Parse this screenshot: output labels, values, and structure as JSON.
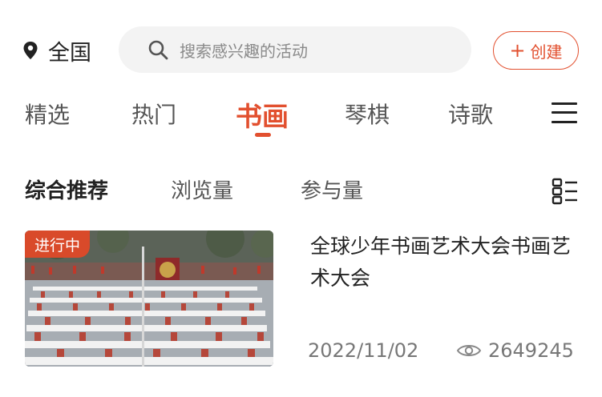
{
  "header": {
    "location": "全国",
    "search_placeholder": "搜索感兴趣的活动",
    "create_label": "创建",
    "create_plus": "+"
  },
  "categories": [
    {
      "label": "精选",
      "active": false
    },
    {
      "label": "热门",
      "active": false
    },
    {
      "label": "书画",
      "active": true
    },
    {
      "label": "琴棋",
      "active": false
    },
    {
      "label": "诗歌",
      "active": false
    }
  ],
  "sort_options": [
    {
      "label": "综合推荐",
      "active": true
    },
    {
      "label": "浏览量",
      "active": false
    },
    {
      "label": "参与量",
      "active": false
    }
  ],
  "activities": [
    {
      "status": "进行中",
      "title": "全球少年书画艺术大会书画艺术大会",
      "date": "2022/11/02",
      "views": "2649245"
    }
  ],
  "colors": {
    "accent": "#e2502f",
    "badge": "#d94a2a",
    "search_bg": "#f3f3f3"
  }
}
